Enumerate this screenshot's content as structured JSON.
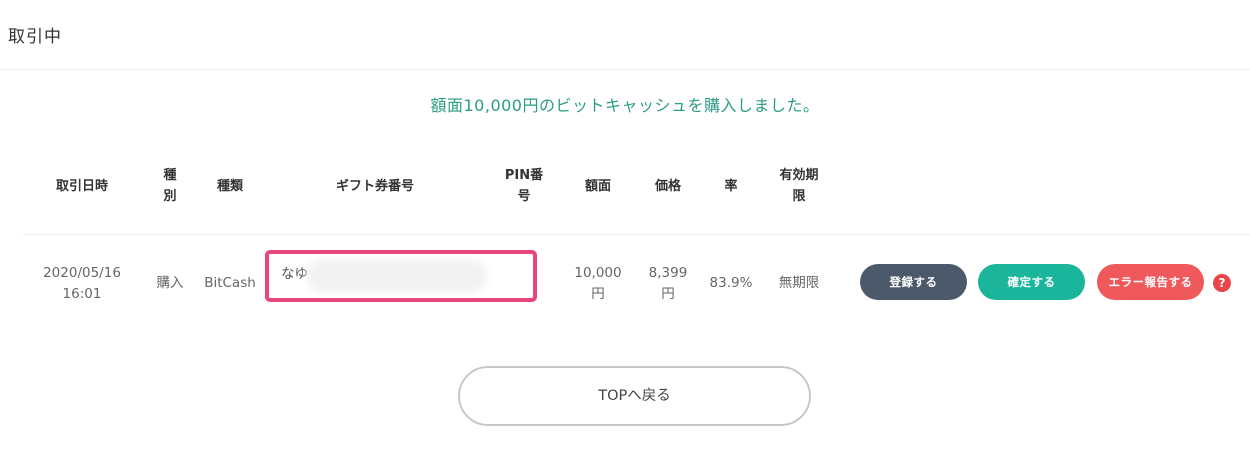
{
  "page_title": "取引中",
  "notice": "額面10,000円のビットキャッシュを購入しました。",
  "table": {
    "headers": {
      "date": "取引日時",
      "kind_1": "種",
      "kind_2": "別",
      "type": "種類",
      "gift_number": "ギフト券番号",
      "pin_1": "PIN番",
      "pin_2": "号",
      "face_value": "額面",
      "price": "価格",
      "rate": "率",
      "expiry_1": "有効期",
      "expiry_2": "限"
    },
    "row": {
      "date_1": "2020/05/16",
      "date_2": "16:01",
      "kind": "購入",
      "type": "BitCash",
      "gift_number": "なゆ",
      "face_value_1": "10,000",
      "face_value_2": "円",
      "price_1": "8,399",
      "price_2": "円",
      "rate": "83.9%",
      "expiry": "無期限"
    }
  },
  "buttons": {
    "register": "登録する",
    "confirm": "確定する",
    "error_report": "エラー報告する"
  },
  "help_icon": "?",
  "top_button": "TOPへ戻る",
  "colors": {
    "notice": "#2a9d84",
    "register": "#4b596b",
    "confirm": "#1ab59a",
    "error": "#f0595b",
    "highlight": "#e8457a"
  }
}
